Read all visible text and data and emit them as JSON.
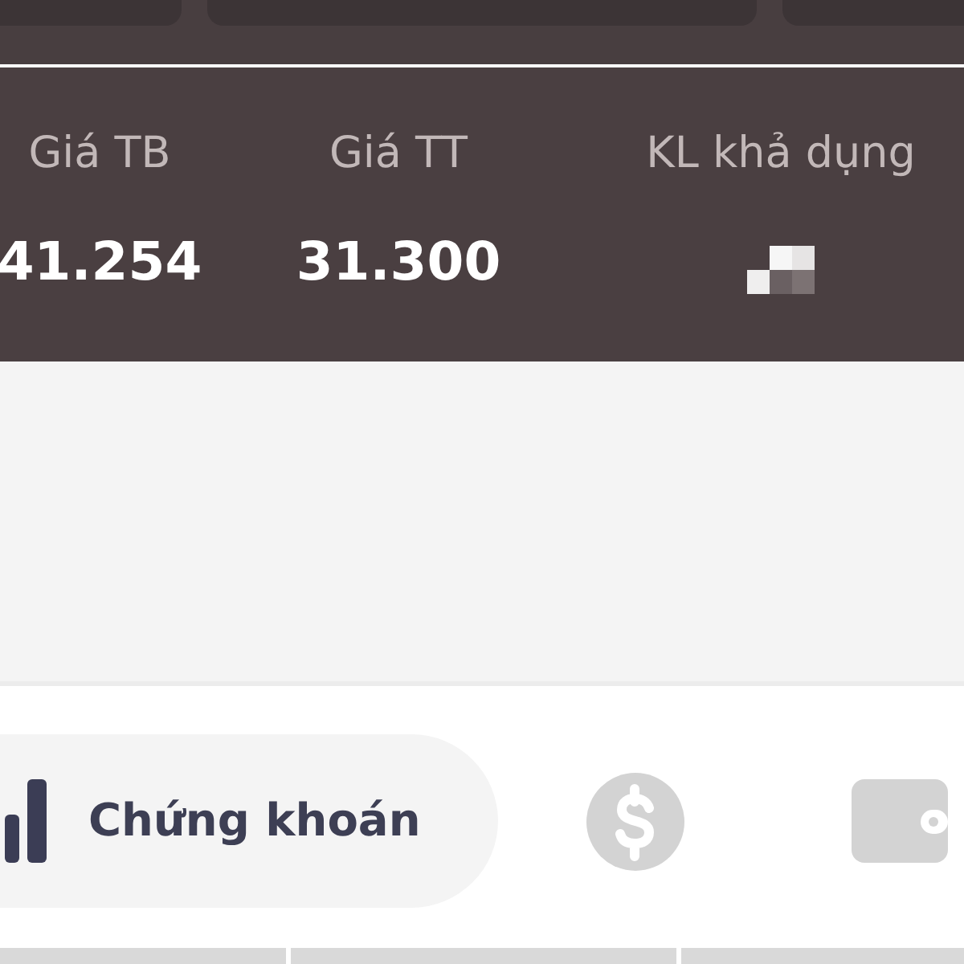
{
  "summary": {
    "columns": [
      {
        "label": "Giá TB",
        "kind": "value",
        "value": "41.254"
      },
      {
        "label": "Giá TT",
        "kind": "value",
        "value": "31.300"
      },
      {
        "label": "KL khả dụng",
        "kind": "masked"
      }
    ]
  },
  "nav": {
    "items": [
      {
        "label": "Chứng khoán",
        "selected": true
      },
      {
        "selected": false
      },
      {
        "selected": false
      }
    ]
  }
}
